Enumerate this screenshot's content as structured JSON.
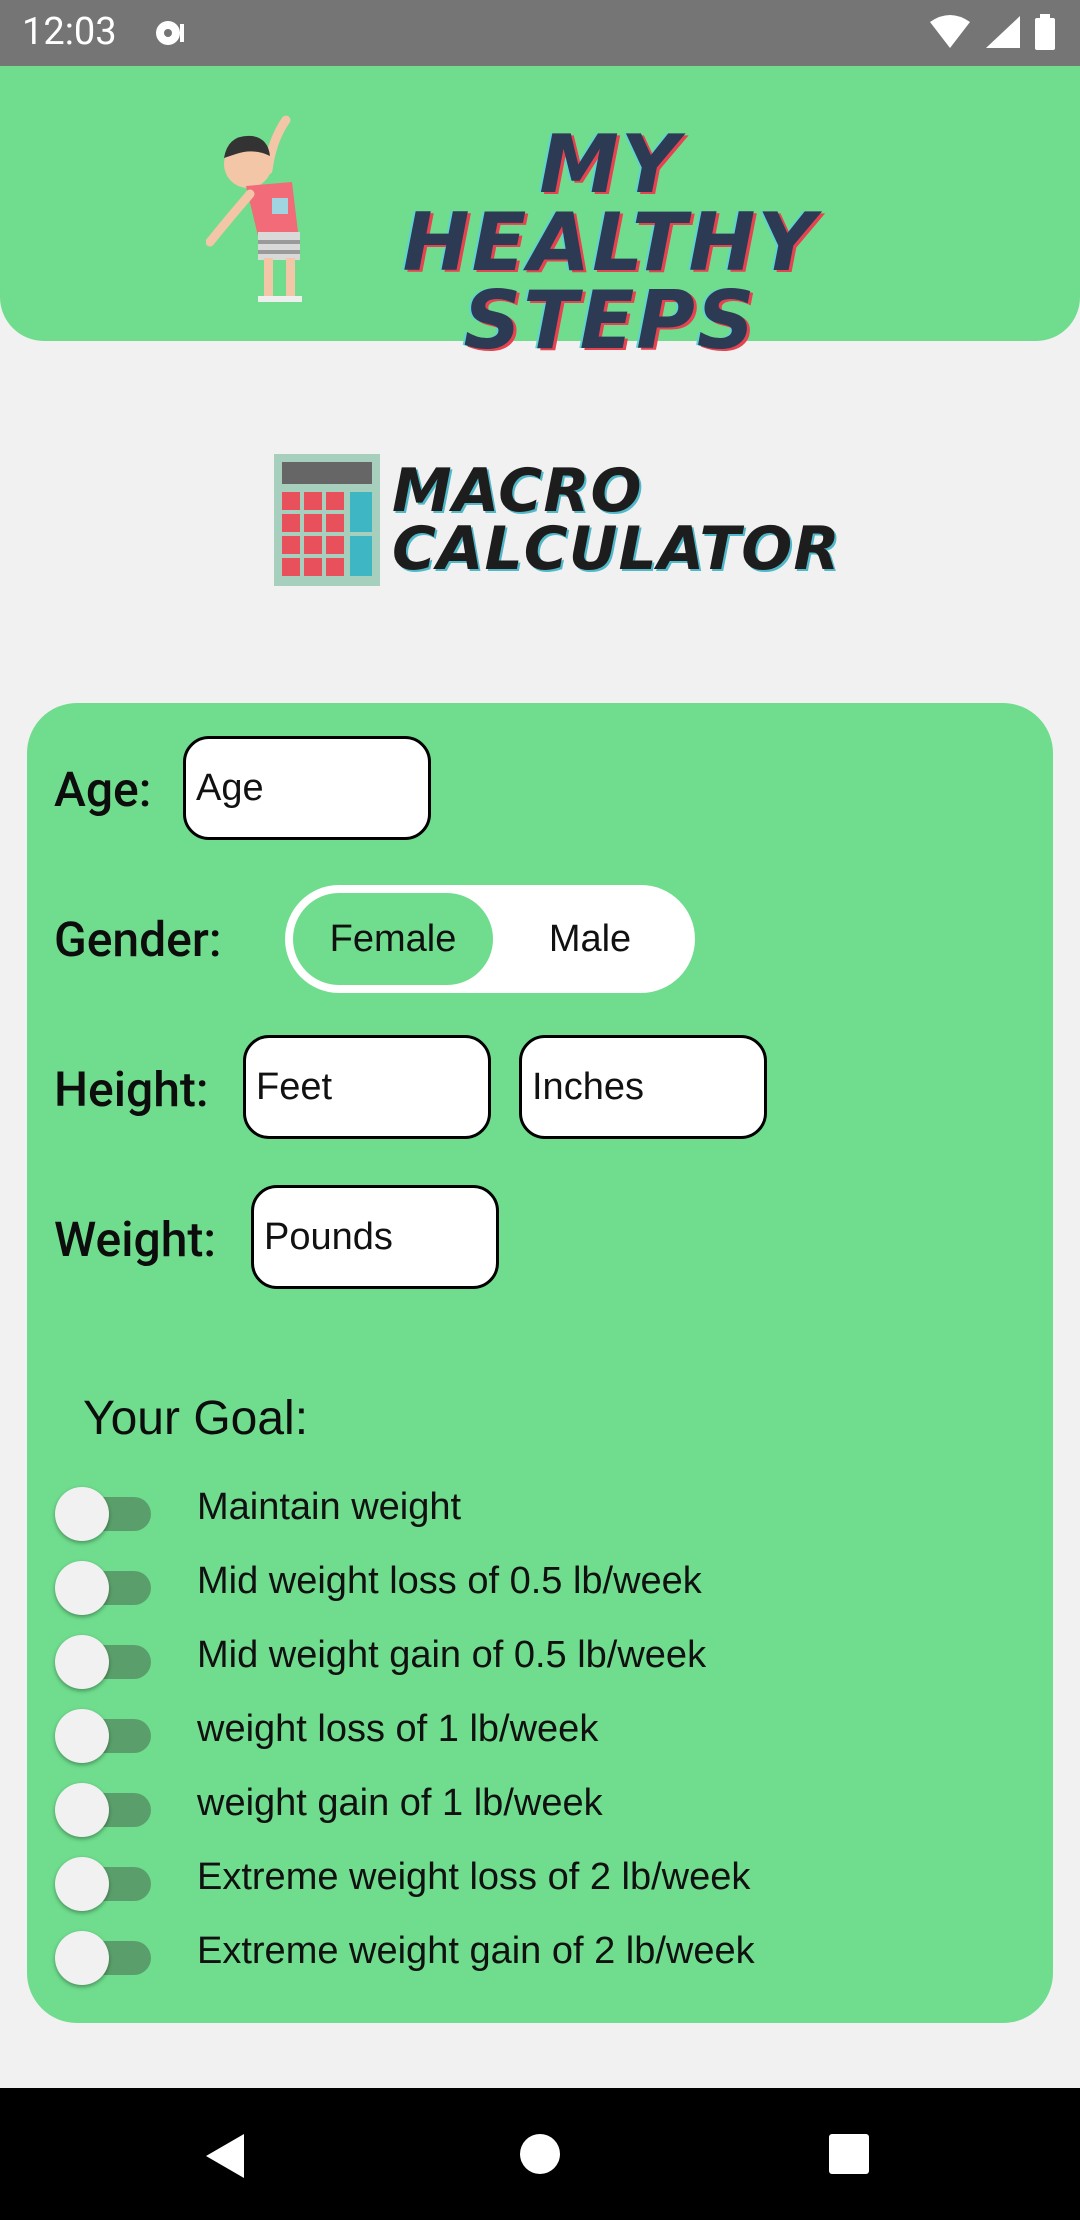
{
  "status_bar": {
    "time": "12:03"
  },
  "header": {
    "brand_line1": "MY HEALTHY",
    "brand_line2": "STEPS"
  },
  "page_logo": {
    "line1": "MACRO",
    "line2": "CALCULATOR"
  },
  "form": {
    "age": {
      "label": "Age:",
      "placeholder": "Age"
    },
    "gender": {
      "label": "Gender:",
      "options": [
        "Female",
        "Male"
      ],
      "selected": "Female"
    },
    "height": {
      "label": "Height:",
      "feet_placeholder": "Feet",
      "inches_placeholder": "Inches"
    },
    "weight": {
      "label": "Weight:",
      "placeholder": "Pounds"
    }
  },
  "goal": {
    "title": "Your Goal:",
    "options": [
      {
        "label": "Maintain weight",
        "checked": false
      },
      {
        "label": "Mid weight loss of 0.5 lb/week",
        "checked": false
      },
      {
        "label": "Mid weight gain of 0.5 lb/week",
        "checked": false
      },
      {
        "label": "weight loss of 1 lb/week",
        "checked": false
      },
      {
        "label": "weight gain of 1 lb/week",
        "checked": false
      },
      {
        "label": "Extreme weight loss of 2 lb/week",
        "checked": false
      },
      {
        "label": "Extreme weight gain of 2 lb/week",
        "checked": false
      }
    ]
  },
  "colors": {
    "accent_green": "#6fdd8d",
    "switch_track": "#5a9f6b",
    "status_bar": "#757575",
    "background": "#f1f1f1"
  }
}
